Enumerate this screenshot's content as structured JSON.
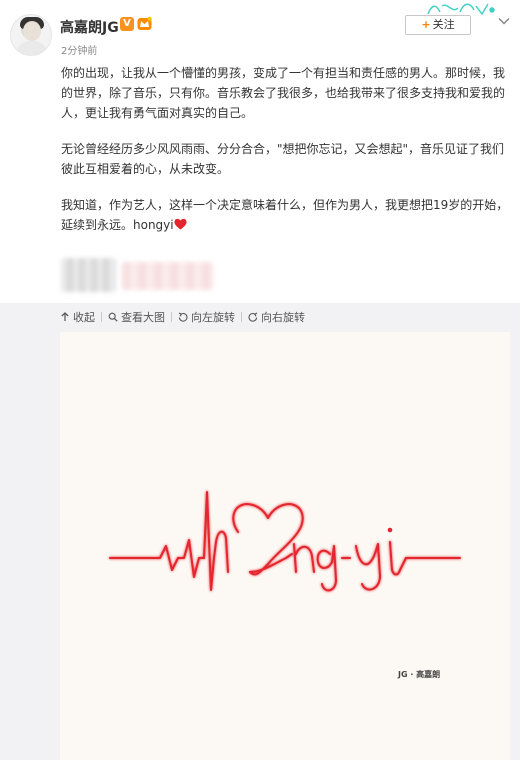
{
  "user": {
    "name": "高嘉朗JG",
    "verified_badge": "V",
    "time": "2分钟前"
  },
  "actions": {
    "follow_plus": "+",
    "follow_label": "关注"
  },
  "post": {
    "paragraphs": [
      "你的出现，让我从一个懵懂的男孩，变成了一个有担当和责任感的男人。那时候，我的世界，除了音乐，只有你。音乐教会了我很多，也给我带来了很多支持我和爱我的人，更让我有勇气面对真实的自己。",
      "无论曾经经历多少风风雨雨、分分合合，\"想把你忘记，又会想起\"，音乐见证了我们彼此互相爱着的心，从未改变。",
      "我知道，作为艺人，这样一个决定意味着什么，但作为男人，我更想把19岁的开始，延续到永远。hongyi"
    ]
  },
  "toolbar": {
    "collapse": "收起",
    "view_large": "查看大图",
    "rotate_left": "向左旋转",
    "rotate_right": "向右旋转"
  },
  "image": {
    "signature": "JG · 高嘉朗",
    "line_color": "#e4252e"
  },
  "colors": {
    "accent_orange": "#ff8200",
    "heart_red": "#e4252e"
  }
}
